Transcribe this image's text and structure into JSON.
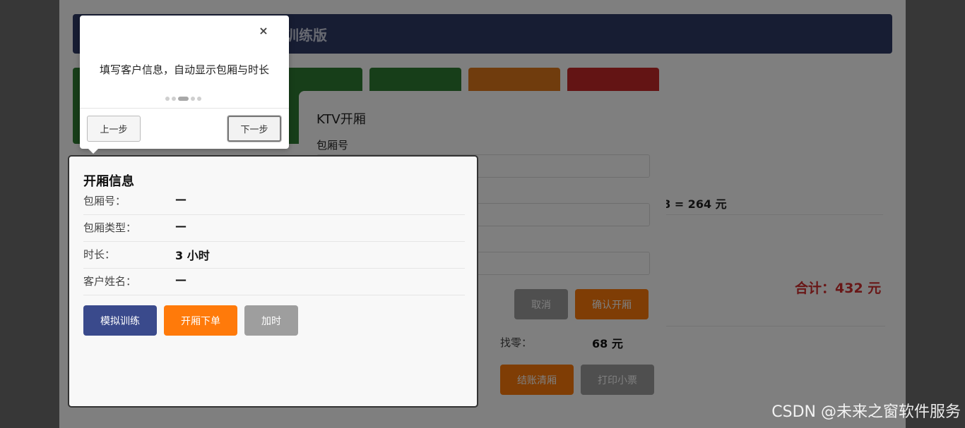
{
  "app": {
    "title_fragment": "训练版",
    "calc_text": "8 = 264 元",
    "total": "合计：432 元",
    "change_label": "找零：",
    "change_value": "68 元",
    "checkout_label": "结账清厢",
    "print_label": "打印小票",
    "tile_colors": [
      "#2e7d32",
      "#2e7d32",
      "#2e7d32",
      "#e0781a",
      "#c62828"
    ]
  },
  "dialog": {
    "title": "KTV开厢",
    "room_label": "包厢号",
    "cancel_label": "取消",
    "confirm_label": "确认开厢"
  },
  "info": {
    "title": "开厢信息",
    "rows": [
      {
        "label": "包厢号：",
        "value": "—"
      },
      {
        "label": "包厢类型：",
        "value": "—"
      },
      {
        "label": "时长：",
        "value": "3 小时"
      },
      {
        "label": "客户姓名：",
        "value": "—"
      }
    ],
    "buttons": {
      "simulate": "模拟训练",
      "order": "开厢下单",
      "extend": "加时"
    }
  },
  "tour": {
    "close_glyph": "×",
    "text": "填写客户信息，自动显示包厢与时长",
    "steps_total": 5,
    "current_step": 3,
    "prev_label": "上一步",
    "next_label": "下一步"
  },
  "watermark": "CSDN @未来之窗软件服务",
  "colors": {
    "primary": "#3a4a8c",
    "orange": "#ff7a0a",
    "gray": "#9e9e9e",
    "header": "#2f3a66"
  }
}
